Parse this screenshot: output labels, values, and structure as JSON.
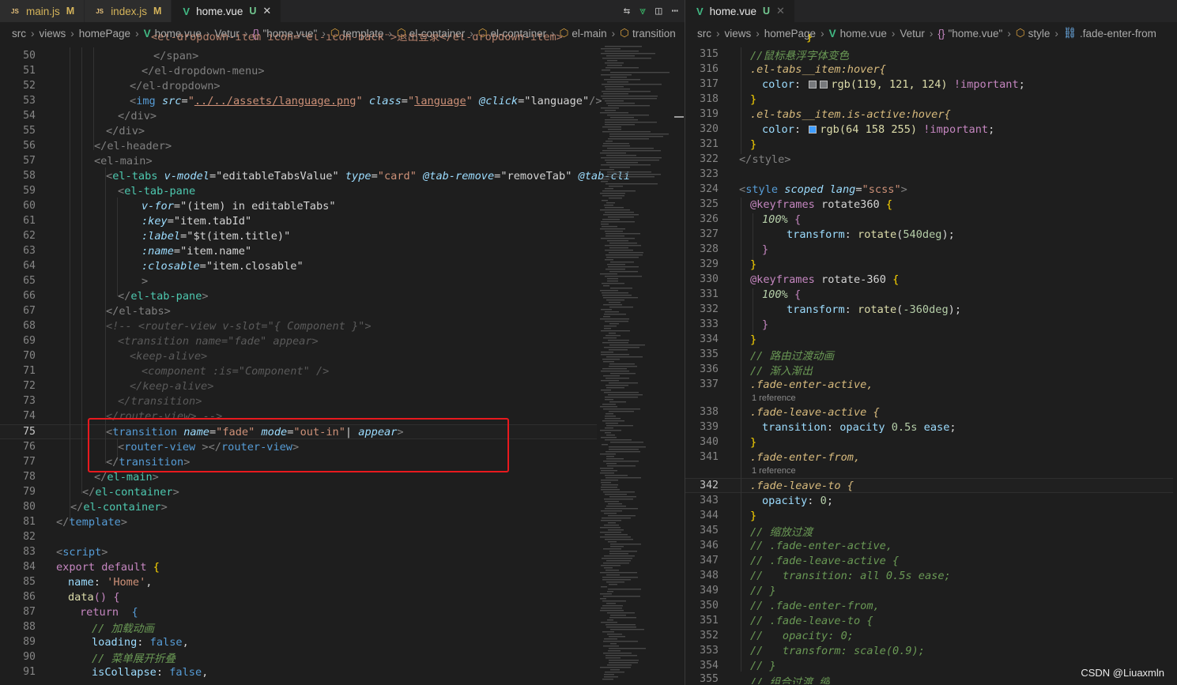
{
  "left_tabs": [
    {
      "label": "main.js",
      "status": "M",
      "icon": "JS"
    },
    {
      "label": "index.js",
      "status": "M",
      "icon": "JS"
    },
    {
      "label": "home.vue",
      "status": "U",
      "icon": "V"
    }
  ],
  "left_breadcrumb": [
    "src",
    "views",
    "homePage",
    "home.vue",
    "Vetur",
    "\"home.vue\"",
    "template",
    "el-container",
    "el-container",
    "el-main",
    "transition"
  ],
  "right_tab": {
    "label": "home.vue",
    "status": "U"
  },
  "right_breadcrumb": [
    "src",
    "views",
    "homePage",
    "home.vue",
    "Vetur",
    "\"home.vue\"",
    "style",
    ".fade-enter-from"
  ],
  "left_line_numbers": [
    "50",
    "51",
    "52",
    "53",
    "54",
    "55",
    "56",
    "57",
    "58",
    "59",
    "60",
    "61",
    "62",
    "63",
    "64",
    "65",
    "66",
    "67",
    "68",
    "69",
    "70",
    "71",
    "72",
    "73",
    "74",
    "75",
    "76",
    "77",
    "78",
    "79",
    "80",
    "81",
    "82",
    "83",
    "84",
    "85",
    "86",
    "87",
    "88",
    "89",
    "90",
    "91"
  ],
  "left_current_line": "75",
  "right_line_numbers": [
    "315",
    "316",
    "317",
    "318",
    "319",
    "320",
    "321",
    "322",
    "323",
    "324",
    "325",
    "326",
    "327",
    "328",
    "329",
    "330",
    "331",
    "332",
    "333",
    "334",
    "335",
    "336",
    "337",
    "338",
    "339",
    "340",
    "341",
    "342",
    "343",
    "344",
    "345",
    "346",
    "347",
    "348",
    "349",
    "350",
    "351",
    "352",
    "353",
    "354",
    "355"
  ],
  "right_current_line": "342",
  "reference_label": "1 reference",
  "left_code": {
    "top_partial": "<el-dropdown-item icon=\"el-icon-back\">退出登录</el-dropdown-item>",
    "l50": "</span>",
    "l51": "</el-dropdown-menu>",
    "l52": "</el-dropdown>",
    "l53_src": "../../assets/language.png",
    "l53_class": "language",
    "l53_click": "language",
    "l54": "</div>",
    "l55": "</div>",
    "l56": "</el-header>",
    "l57": "<el-main>",
    "l58_model": "editableTabsValue",
    "l58_type": "card",
    "l58_remove": "removeTab",
    "l60_vfor": "(item) in editableTabs",
    "l61_key": "item.tabId",
    "l62_label": "$t(item.title)",
    "l63_name": "item.name",
    "l64_closable": "item.closable",
    "l67": "</el-tabs>",
    "l68": "<!-- <router-view v-slot=\"{ Component }\">",
    "l69": "<transition name=\"fade\" appear>",
    "l70": "<keep-alive>",
    "l71": "<component :is=\"Component\" />",
    "l72": "</keep-alive>",
    "l73": "</transition>",
    "l74": "</router-view> -->",
    "l75_name": "fade",
    "l75_mode": "out-in",
    "l88": "// 加载动画",
    "l90": "// 菜单展开折叠",
    "l84_name": "Home"
  },
  "right_code": {
    "l315": "//鼠标悬浮字体变色",
    "l316": ".el-tabs__item:hover{",
    "l317_color": "rgb(119, 121, 124)",
    "l319": ".el-tabs__item.is-active:hover{",
    "l320_color": "rgb(64 158 255)",
    "l322": "</style>",
    "l324_lang": "scss",
    "l325_name": "rotate360",
    "l327_val": "540deg",
    "l330_name": "rotate-360",
    "l332_val": "-360deg",
    "l335": "// 路由过渡动画",
    "l336": "// 渐入渐出",
    "l337": ".fade-enter-active,",
    "l338": ".fade-leave-active {",
    "l339_dur": "0.5s",
    "l341": ".fade-enter-from,",
    "l342": ".fade-leave-to {",
    "l345": "// 缩放过渡",
    "l346": "// .fade-enter-active,",
    "l347": "// .fade-leave-active {",
    "l348": "//   transition: all 0.5s ease;",
    "l349": "// }",
    "l350": "// .fade-enter-from,",
    "l351": "// .fade-leave-to {",
    "l352": "//   opacity: 0;",
    "l353": "//   transform: scale(0.9);",
    "l354": "// }",
    "l355": "// 组合过渡 缩"
  },
  "watermark": "CSDN @Liuaxmln"
}
